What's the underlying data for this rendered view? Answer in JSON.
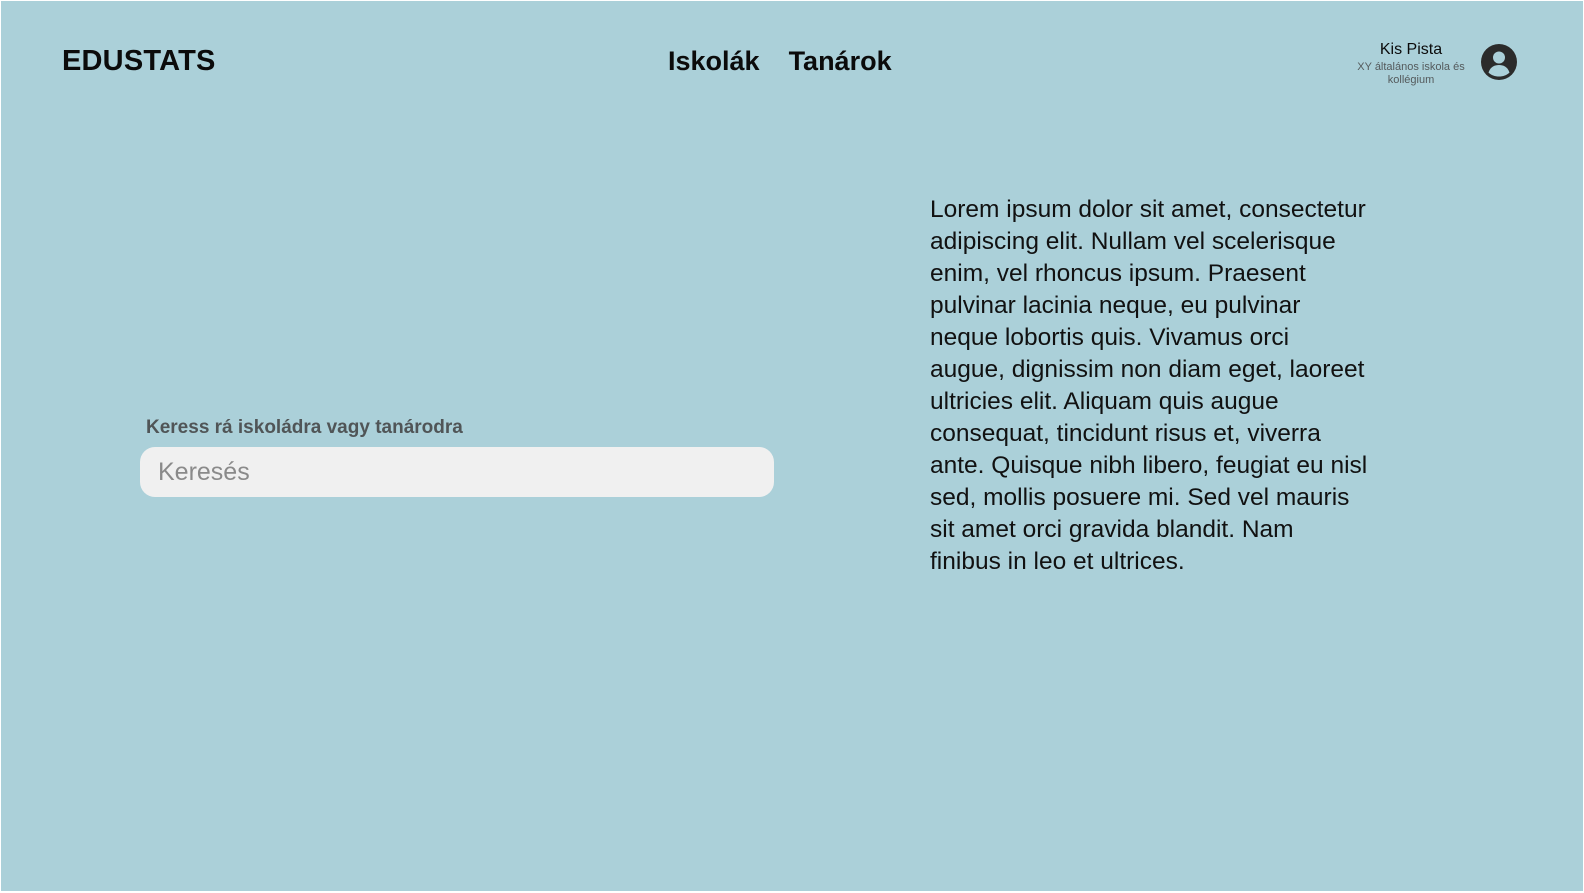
{
  "app": {
    "logo": "EDUSTATS"
  },
  "nav": {
    "items": [
      {
        "label": "Iskolák"
      },
      {
        "label": "Tanárok"
      }
    ]
  },
  "user": {
    "name": "Kis Pista",
    "school": "XY általános iskola és kollégium",
    "avatar_icon": "user-circle-icon"
  },
  "search": {
    "label": "Keress rá iskoládra vagy tanárodra",
    "value": "",
    "placeholder": "Keresés"
  },
  "content": {
    "paragraph": "Lorem ipsum dolor sit amet, consectetur adipiscing elit. Nullam vel scelerisque enim, vel rhoncus ipsum. Praesent pulvinar lacinia neque, eu pulvinar neque lobortis quis. Vivamus orci augue, dignissim non diam eget, laoreet ultricies elit. Aliquam quis augue consequat, tincidunt risus et, viverra ante. Quisque nibh libero, feugiat eu nisl sed, mollis posuere mi. Sed vel mauris sit amet orci gravida blandit. Nam finibus in leo et ultrices."
  },
  "colors": {
    "background": "#abd0d9",
    "search_field": "#f0f0f0",
    "text": "#0b0b0b"
  }
}
